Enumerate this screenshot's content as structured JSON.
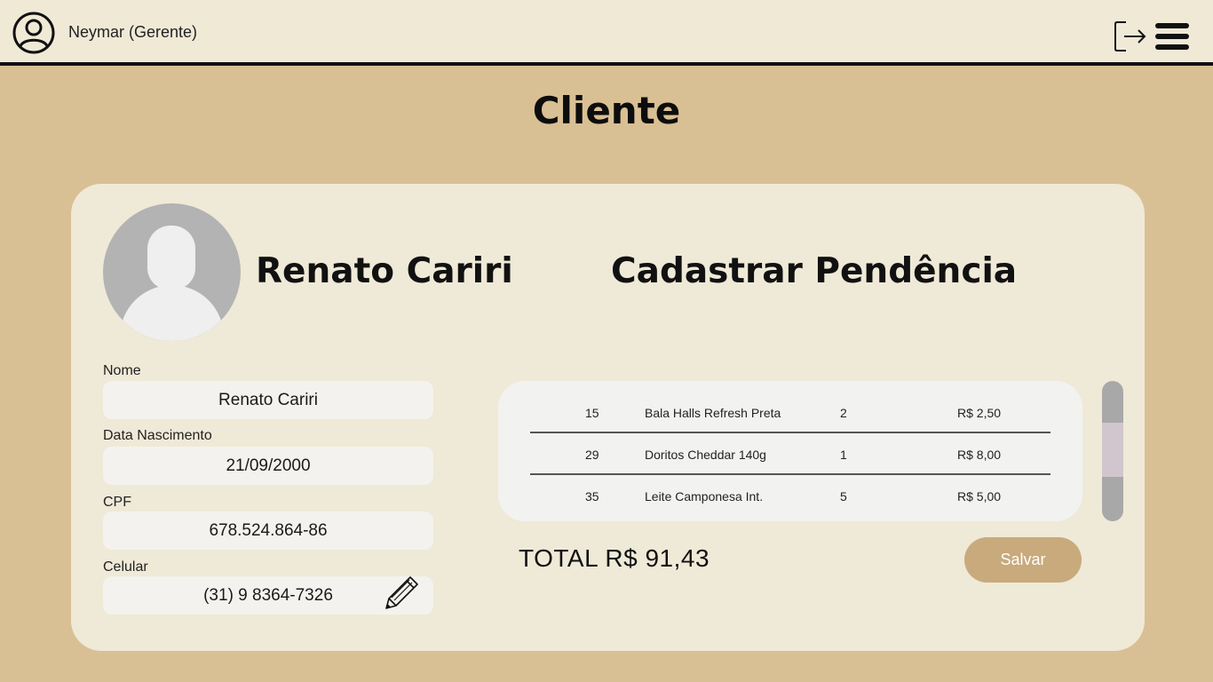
{
  "header": {
    "user_label": "Neymar (Gerente)",
    "user_icon": "user-circle-icon",
    "logout_icon": "logout-icon",
    "menu_icon": "hamburger-menu-icon"
  },
  "page": {
    "title": "Cliente"
  },
  "client": {
    "display_name": "Renato Cariri",
    "avatar_icon": "default-avatar-icon",
    "fields": {
      "nome": {
        "label": "Nome",
        "value": "Renato Cariri"
      },
      "nascimento": {
        "label": "Data Nascimento",
        "value": "21/09/2000"
      },
      "cpf": {
        "label": "CPF",
        "value": "678.524.864-86"
      },
      "celular": {
        "label": "Celular",
        "value": "(31) 9 8364-7326"
      }
    },
    "edit_icon": "pencil-icon"
  },
  "pendencia": {
    "title": "Cadastrar Pendência",
    "rows": [
      {
        "code": "15",
        "desc": "Bala Halls Refresh Preta",
        "qty": "2",
        "price": "R$ 2,50"
      },
      {
        "code": "29",
        "desc": "Doritos Cheddar 140g",
        "qty": "1",
        "price": "R$ 8,00"
      },
      {
        "code": "35",
        "desc": "Leite Camponesa Int.",
        "qty": "5",
        "price": "R$ 5,00"
      }
    ],
    "total": "TOTAL R$ 91,43",
    "save_label": "Salvar"
  },
  "colors": {
    "background": "#d9bf94",
    "topbar": "#efe9d6",
    "card": "#efe9d7",
    "button": "#c9aa7c",
    "scroll_thumb": "#d1c6cd"
  }
}
